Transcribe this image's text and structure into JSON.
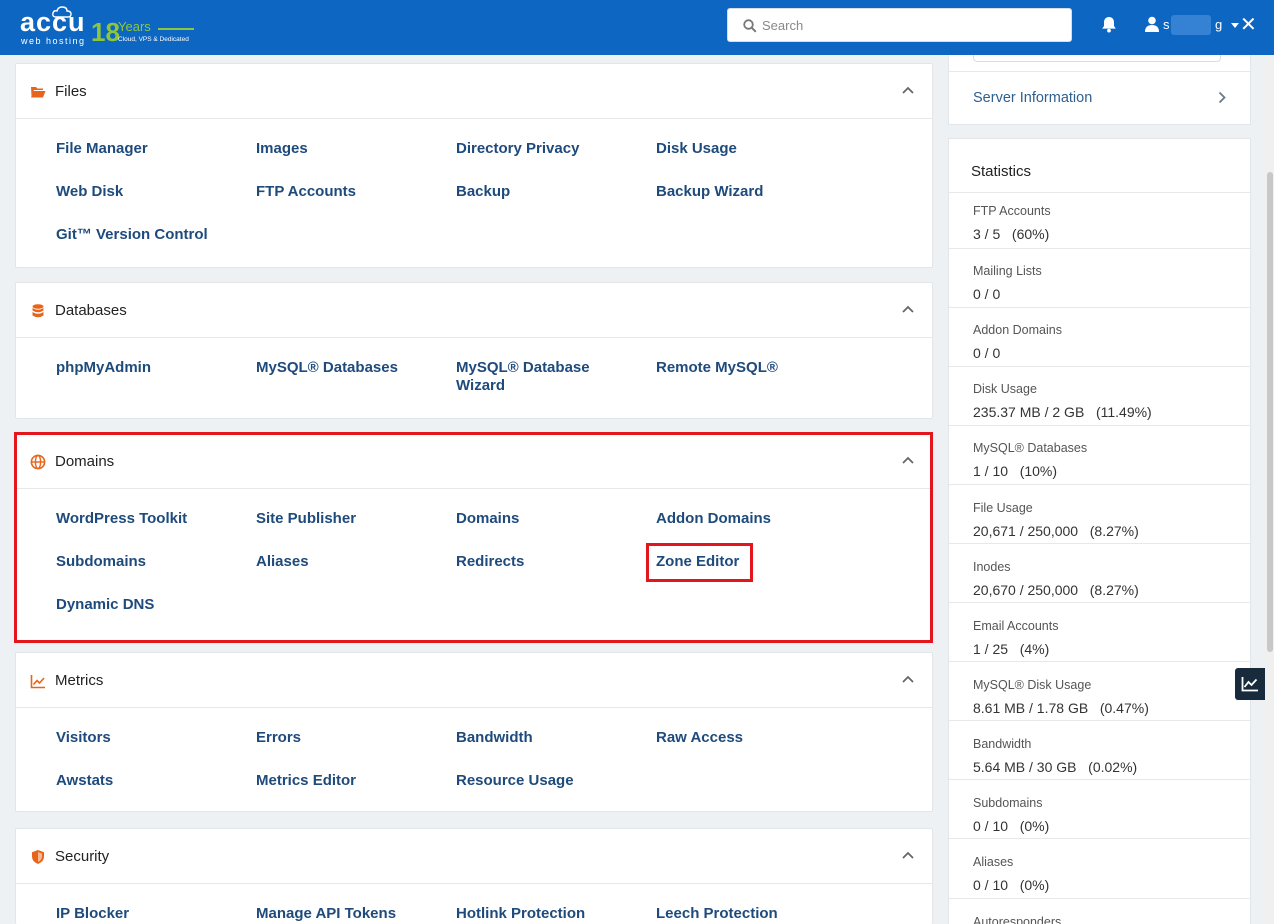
{
  "header": {
    "logo_main": "accu",
    "logo_sub": "web hosting",
    "logo_years_num": "18",
    "logo_years_word": "Years",
    "logo_tagline": "Cloud, VPS & Dedicated",
    "search_placeholder": "Search",
    "user_initial": "s",
    "user_suffix": "g",
    "colors": {
      "bar": "#0d66c2",
      "accent": "#8cc63f"
    }
  },
  "sections": {
    "files": {
      "title": "Files",
      "links": [
        "File Manager",
        "Images",
        "Directory Privacy",
        "Disk Usage",
        "Web Disk",
        "FTP Accounts",
        "Backup",
        "Backup Wizard",
        "Git™ Version Control"
      ]
    },
    "databases": {
      "title": "Databases",
      "links": [
        "phpMyAdmin",
        "MySQL® Databases",
        "MySQL® Database Wizard",
        "Remote MySQL®"
      ]
    },
    "domains": {
      "title": "Domains",
      "links": [
        "WordPress Toolkit",
        "Site Publisher",
        "Domains",
        "Addon Domains",
        "Subdomains",
        "Aliases",
        "Redirects",
        "Zone Editor",
        "Dynamic DNS"
      ]
    },
    "metrics": {
      "title": "Metrics",
      "links": [
        "Visitors",
        "Errors",
        "Bandwidth",
        "Raw Access",
        "Awstats",
        "Metrics Editor",
        "Resource Usage"
      ]
    },
    "security": {
      "title": "Security",
      "links": [
        "IP Blocker",
        "Manage API Tokens",
        "Hotlink Protection",
        "Leech Protection"
      ]
    }
  },
  "sidebar": {
    "server_information": "Server Information",
    "statistics_title": "Statistics",
    "stats": [
      {
        "label": "FTP Accounts",
        "value": "3 / 5   (60%)"
      },
      {
        "label": "Mailing Lists",
        "value": "0 / 0"
      },
      {
        "label": "Addon Domains",
        "value": "0 / 0"
      },
      {
        "label": "Disk Usage",
        "value": "235.37 MB / 2 GB   (11.49%)"
      },
      {
        "label": "MySQL® Databases",
        "value": "1 / 10   (10%)"
      },
      {
        "label": "File Usage",
        "value": "20,671 / 250,000   (8.27%)"
      },
      {
        "label": "Inodes",
        "value": "20,670 / 250,000   (8.27%)"
      },
      {
        "label": "Email Accounts",
        "value": "1 / 25   (4%)"
      },
      {
        "label": "MySQL® Disk Usage",
        "value": "8.61 MB / 1.78 GB   (0.47%)"
      },
      {
        "label": "Bandwidth",
        "value": "5.64 MB / 30 GB   (0.02%)"
      },
      {
        "label": "Subdomains",
        "value": "0 / 10   (0%)"
      },
      {
        "label": "Aliases",
        "value": "0 / 10   (0%)"
      },
      {
        "label": "Autoresponders",
        "value": ""
      }
    ]
  }
}
